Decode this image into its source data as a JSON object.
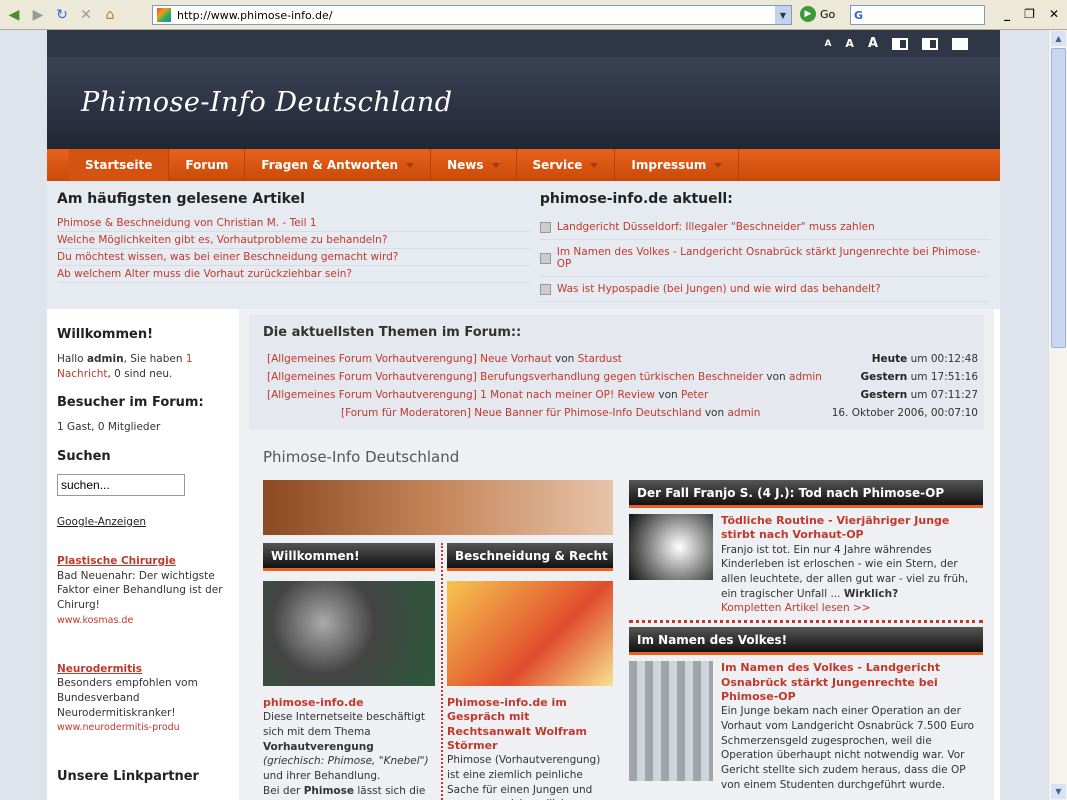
{
  "browser": {
    "url": "http://www.phimose-info.de/",
    "go_label": "Go",
    "search_value": "G"
  },
  "site": {
    "logo": "Phimose-Info Deutschland",
    "font_sizes": [
      "A",
      "A",
      "A"
    ],
    "nav": [
      "Startseite",
      "Forum",
      "Fragen & Antworten",
      "News",
      "Service",
      "Impressum"
    ]
  },
  "top_articles": {
    "title": "Am häufigsten gelesene Artikel",
    "items": [
      "Phimose & Beschneidung von Christian M. - Teil 1",
      "Welche Möglichkeiten gibt es, Vorhautprobleme zu behandeln?",
      "Du möchtest wissen, was bei einer Beschneidung gemacht wird?",
      "Ab welchem Alter muss die Vorhaut zurückziehbar sein?"
    ]
  },
  "news": {
    "title": "phimose-info.de aktuell:",
    "items": [
      "Landgericht Düsseldorf: Illegaler \"Beschneider\" muss zahlen",
      "Im Namen des Volkes - Landgericht Osnabrück stärkt Jungenrechte bei Phimose-OP",
      "Was ist Hypospadie (bei Jungen) und wie wird das behandelt?"
    ]
  },
  "sidebar": {
    "welcome_title": "Willkommen!",
    "welcome_pre": "Hallo ",
    "user": "admin",
    "welcome_mid": ", Sie haben ",
    "msg_link": "1 Nachricht",
    "welcome_post": ", 0 sind neu.",
    "visitors_title": "Besucher im Forum:",
    "visitors_text": "1 Gast, 0 Mitglieder",
    "search_title": "Suchen",
    "search_placeholder": "suchen...",
    "ads_label": "Google-Anzeigen",
    "ads": [
      {
        "title": "Plastische Chirurgie",
        "text": "Bad Neuenahr: Der wichtigste Faktor einer Behandlung ist der Chirurg!",
        "url": "www.kosmas.de"
      },
      {
        "title": "Neurodermitis",
        "text": "Besonders empfohlen vom Bundesverband Neurodermitiskranker!",
        "url": "www.neurodermitis-produ"
      }
    ],
    "partners_title": "Unsere Linkpartner"
  },
  "forum": {
    "title": "Die aktuellsten Themen im Forum::",
    "rows": [
      {
        "board": "[Allgemeines Forum Vorhautverengung]",
        "topic": "Neue Vorhaut",
        "by": " von ",
        "author": "Stardust",
        "day": "Heute",
        "time": " um 00:12:48"
      },
      {
        "board": "[Allgemeines Forum Vorhautverengung]",
        "topic": "Berufungsverhandlung gegen türkischen Beschneider",
        "by": " von ",
        "author": "admin",
        "day": "Gestern",
        "time": " um 17:51:16"
      },
      {
        "board": "[Allgemeines Forum Vorhautverengung]",
        "topic": "1 Monat nach meiner OP! Review",
        "by": " von ",
        "author": "Peter",
        "day": "Gestern",
        "time": " um 07:11:27"
      },
      {
        "board": "[Forum für Moderatoren]",
        "topic": "Neue Banner für Phimose-Info Deutschland",
        "by": " von ",
        "author": "admin",
        "day": "",
        "time": "16. Oktober 2006, 00:07:10"
      }
    ]
  },
  "main": {
    "section_title": "Phimose-Info Deutschland",
    "welcome_card": {
      "header": "Willkommen!",
      "title": "phimose-info.de",
      "text1": "Diese Internetseite beschäftigt sich mit dem Thema ",
      "bold1": "Vorhautverengung",
      "italic": "(griechisch: Phimose, \"Knebel\")",
      "text2": " und ihrer Behandlung.",
      "text3": "Bei der ",
      "bold2": "Phimose",
      "text4": " lässt sich die"
    },
    "law_card": {
      "header": "Beschneidung & Recht",
      "title": "Phimose-info.de im Gespräch mit Rechtsanwalt Wolfram Störmer",
      "text": "Phimose (Vorhautverengung) ist eine ziemlich peinliche Sache für einen Jungen und wenn man sich endlich überwunden hat, mit den"
    },
    "franjo": {
      "header": "Der Fall Franjo S. (4 J.): Tod nach Phimose-OP",
      "title": "Tödliche Routine - Vierjähriger Junge stirbt nach Vorhaut-OP",
      "text": "Franjo ist tot. Ein nur 4 Jahre währendes Kinderleben ist erloschen - wie ein Stern, der allen leuchtete, der allen gut war - viel zu früh, ein tragischer Unfall ... ",
      "bold": "Wirklich?",
      "more": "Kompletten Artikel lesen >>"
    },
    "volk": {
      "header": "Im Namen des Volkes!",
      "title": "Im Namen des Volkes - Landgericht Osnabrück stärkt Jungenrechte bei Phimose-OP",
      "text": "Ein Junge bekam nach einer Operation an der Vorhaut vom Landgericht Osnabrück 7.500 Euro Schmerzensgeld zugesprochen, weil die Operation überhaupt nicht notwendig war. Vor Gericht stellte sich zudem heraus, dass die OP von einem Studenten durchgeführt wurde."
    }
  }
}
